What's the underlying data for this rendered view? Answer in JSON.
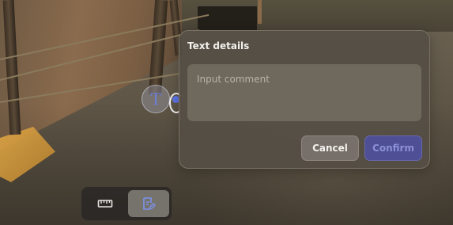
{
  "dialog": {
    "title": "Text details",
    "comment_placeholder": "Input comment",
    "comment_value": "",
    "cancel_label": "Cancel",
    "confirm_label": "Confirm"
  },
  "annotation": {
    "pin_glyph": "T",
    "icon": "text-annotation-icon"
  },
  "toolbar": {
    "tools": [
      {
        "name": "ruler-icon",
        "active": false
      },
      {
        "name": "annotation-edit-icon",
        "active": true
      }
    ]
  },
  "colors": {
    "accent": "#5d74e6",
    "confirm_bg": "#4e4f94",
    "dialog_bg": "#554f46"
  }
}
